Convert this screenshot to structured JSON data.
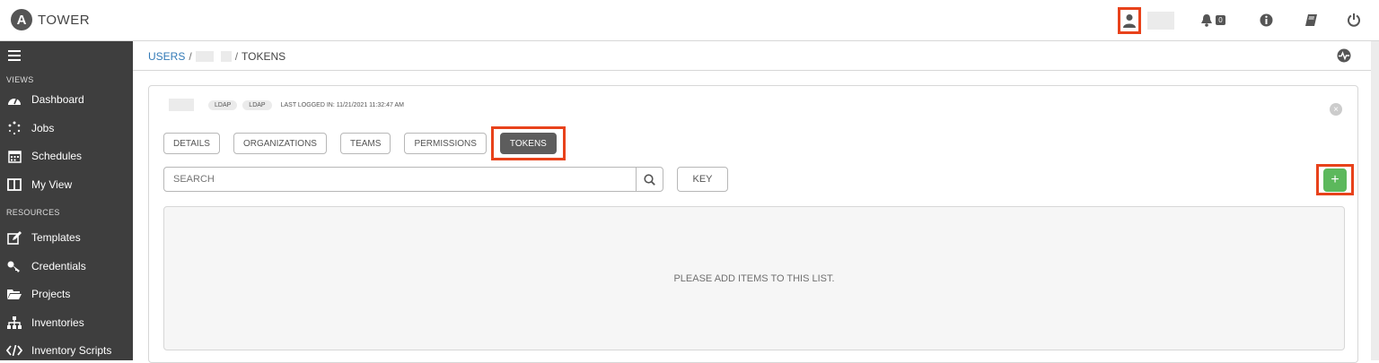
{
  "app": {
    "title": "TOWER",
    "logo_letter": "A"
  },
  "topbar": {
    "notification_count": "0",
    "icons": [
      "user-icon",
      "bell-icon",
      "info-icon",
      "book-icon",
      "power-icon"
    ]
  },
  "sidebar": {
    "sections": [
      {
        "label": "VIEWS"
      },
      {
        "label": "RESOURCES"
      }
    ],
    "items": [
      {
        "label": "Dashboard",
        "icon": "dashboard-icon"
      },
      {
        "label": "Jobs",
        "icon": "jobs-icon"
      },
      {
        "label": "Schedules",
        "icon": "calendar-icon"
      },
      {
        "label": "My View",
        "icon": "columns-icon"
      },
      {
        "label": "Templates",
        "icon": "edit-icon"
      },
      {
        "label": "Credentials",
        "icon": "key-icon"
      },
      {
        "label": "Projects",
        "icon": "folder-icon"
      },
      {
        "label": "Inventories",
        "icon": "sitemap-icon"
      },
      {
        "label": "Inventory Scripts",
        "icon": "code-icon"
      }
    ]
  },
  "breadcrumb": {
    "users": "USERS",
    "sep": "/",
    "current": "TOKENS"
  },
  "user": {
    "tags": [
      "LDAP",
      "LDAP"
    ],
    "last_logged_in": "LAST LOGGED IN: 11/21/2021 11:32:47 AM"
  },
  "tabs": [
    {
      "label": "DETAILS"
    },
    {
      "label": "ORGANIZATIONS"
    },
    {
      "label": "TEAMS"
    },
    {
      "label": "PERMISSIONS"
    },
    {
      "label": "TOKENS",
      "active": true
    }
  ],
  "search": {
    "placeholder": "SEARCH"
  },
  "key_button": "KEY",
  "add_button": "+",
  "empty_message": "PLEASE ADD ITEMS TO THIS LIST.",
  "colors": {
    "sidebar_bg": "#3e3e3e",
    "highlight": "#e8421b",
    "add_green": "#5cb85c",
    "link": "#337ab7"
  }
}
